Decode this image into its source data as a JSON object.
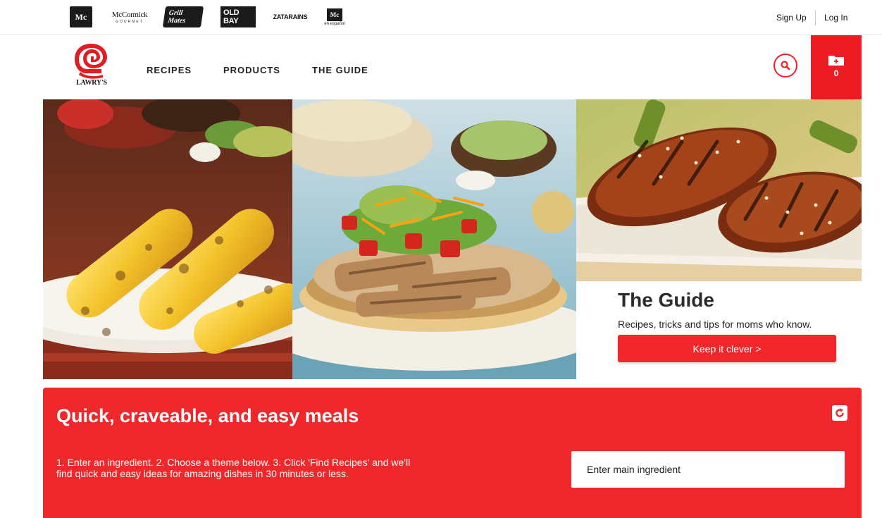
{
  "brand_bar": {
    "brands": [
      {
        "name": "McCormick",
        "mark": "Mc"
      },
      {
        "name": "McCormick",
        "tagline": "GOURMET"
      },
      {
        "name": "Grill Mates"
      },
      {
        "name": "OLD BAY"
      },
      {
        "name": "ZATARAINS",
        "mark": "ZATARAINS"
      },
      {
        "name": "McCormick",
        "mark": "Mc",
        "tagline": "en español"
      }
    ],
    "sign_up": "Sign Up",
    "log_in": "Log In"
  },
  "logo": {
    "text": "LAWRY'S",
    "color": "#e31b23"
  },
  "nav": {
    "recipes": "RECIPES",
    "products": "PRODUCTS",
    "the_guide": "THE GUIDE"
  },
  "header_actions": {
    "search_icon": "search-icon",
    "folder_icon": "recipe-box-icon",
    "saved_count": "0",
    "accent": "#ec1c24"
  },
  "hero": {
    "images": [
      "grilled-corn-photo",
      "chicken-tostada-photo",
      "glazed-chicken-photo"
    ]
  },
  "guide": {
    "title": "The Guide",
    "description": "Recipes, tricks and tips for moms who know.",
    "cta": "Keep it clever >"
  },
  "meals": {
    "title": "Quick, craveable, and easy meals",
    "instructions": "1. Enter an ingredient. 2. Choose a theme below. 3. Click 'Find Recipes' and we'll find quick and easy ideas for amazing dishes in 30 minutes or less.",
    "input_placeholder": "Enter main ingredient",
    "reset_icon": "refresh-icon",
    "panel_color": "#f0272b"
  }
}
